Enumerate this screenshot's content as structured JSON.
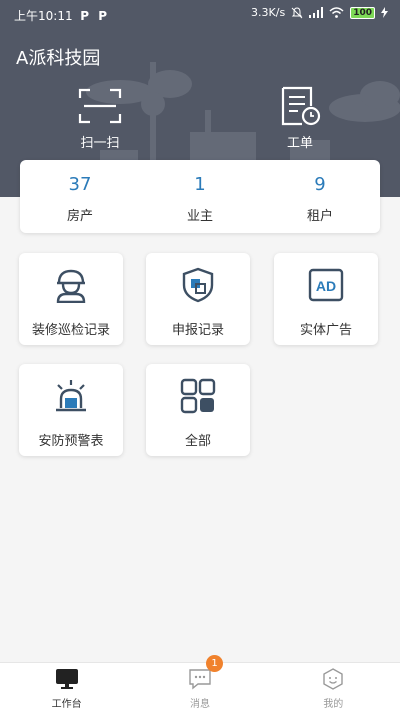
{
  "status_bar": {
    "time": "上午10:11",
    "left_icons": [
      "P",
      "P"
    ],
    "speed": "3.3K/s",
    "battery": "100"
  },
  "park": {
    "title": "A派科技园"
  },
  "quick_actions": [
    {
      "label": "扫一扫",
      "icon": "scan-icon"
    },
    {
      "label": "工单",
      "icon": "work-order-icon"
    }
  ],
  "stats": [
    {
      "value": "37",
      "label": "房产"
    },
    {
      "value": "1",
      "label": "业主"
    },
    {
      "value": "9",
      "label": "租户"
    }
  ],
  "modules": [
    {
      "label": "装修巡检记录",
      "icon": "inspector-icon"
    },
    {
      "label": "申报记录",
      "icon": "shield-icon"
    },
    {
      "label": "实体广告",
      "icon": "ad-icon"
    },
    {
      "label": "安防预警表",
      "icon": "alarm-light-icon"
    },
    {
      "label": "全部",
      "icon": "grid-icon"
    }
  ],
  "tabs": [
    {
      "label": "工作台",
      "icon": "monitor-icon",
      "active": true
    },
    {
      "label": "消息",
      "icon": "message-icon",
      "badge": "1"
    },
    {
      "label": "我的",
      "icon": "profile-icon"
    }
  ],
  "colors": {
    "header": "#525866",
    "accent": "#2b7bb9",
    "icon": "#3d4f63",
    "badge": "#f0822d"
  }
}
